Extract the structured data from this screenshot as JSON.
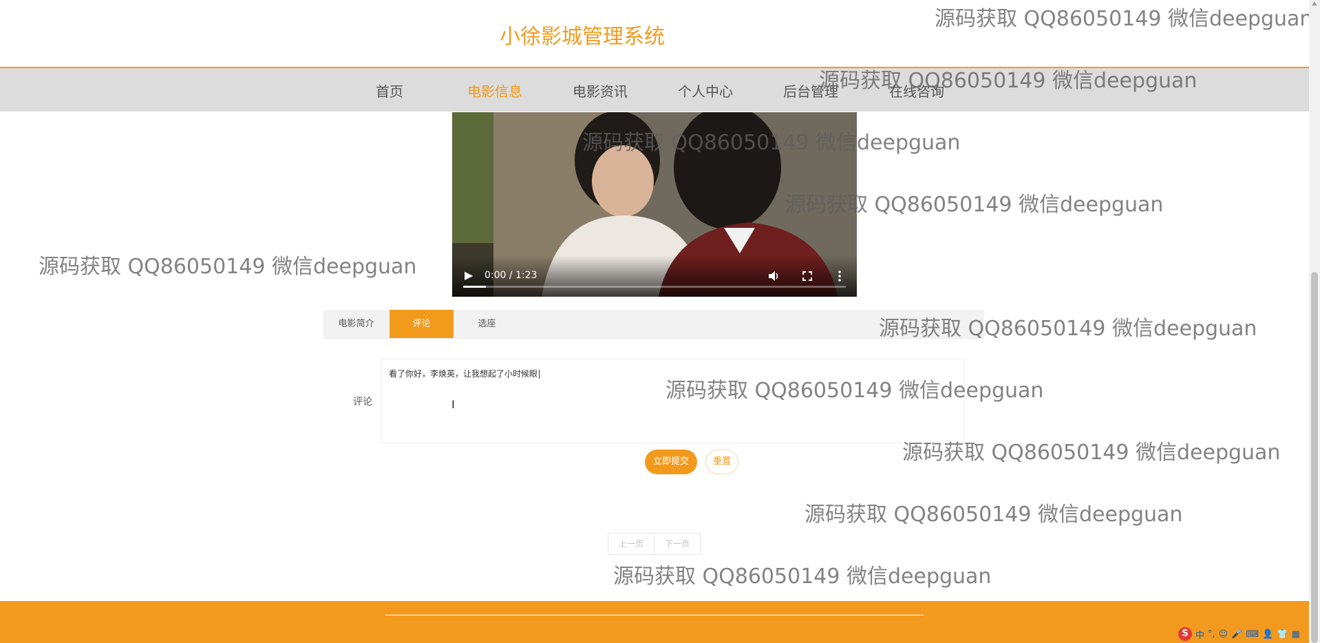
{
  "header": {
    "site_title": "小徐影城管理系统"
  },
  "nav": {
    "items": [
      {
        "label": "首页",
        "active": false
      },
      {
        "label": "电影信息",
        "active": true
      },
      {
        "label": "电影资讯",
        "active": false
      },
      {
        "label": "个人中心",
        "active": false
      },
      {
        "label": "后台管理",
        "active": false
      },
      {
        "label": "在线咨询",
        "active": false
      }
    ]
  },
  "video": {
    "time": "0:00 / 1:23",
    "progress_fraction": 0.06,
    "icons": [
      "play-icon",
      "volume-icon",
      "fullscreen-icon",
      "more-options-icon"
    ]
  },
  "tabs": [
    {
      "label": "电影简介",
      "active": false
    },
    {
      "label": "评论",
      "active": true
    },
    {
      "label": "选座",
      "active": false
    }
  ],
  "comment_form": {
    "label": "评论",
    "value": "看了你好，李焕英，让我想起了小时候眼",
    "submit_label": "立即提交",
    "reset_label": "重置"
  },
  "pagination": {
    "prev_label": "上一页",
    "next_label": "下一页"
  },
  "watermark": {
    "text": "源码获取 QQ86050149 微信deepguan"
  },
  "taskbar": {
    "ime_logo": "S",
    "ime_lang": "中",
    "ime_punct": "°,"
  },
  "colors": {
    "accent": "#f29a1c",
    "nav_bg": "#dcdcdc",
    "footer_bg": "#f39a1e"
  }
}
